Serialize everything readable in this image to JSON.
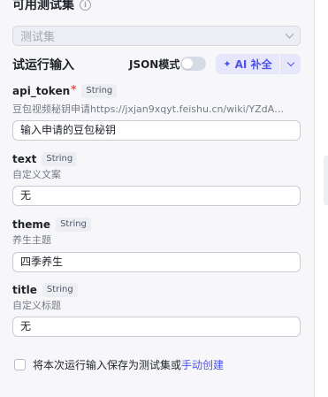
{
  "header": {
    "title": "可用测试集"
  },
  "testset_select": {
    "placeholder": "测试集"
  },
  "run_input": {
    "title": "试运行输入",
    "json_mode_label": "JSON模式",
    "json_mode_on": false,
    "ai_fill_label": "AI 补全"
  },
  "fields": [
    {
      "name": "api_token",
      "required": true,
      "type": "String",
      "description": "豆包视频秘钥申请https://jxjan9xqyt.feishu.cn/wiki/YZdA…",
      "value": "输入申请的豆包秘钥"
    },
    {
      "name": "text",
      "required": false,
      "type": "String",
      "description": "自定义文案",
      "value": "无"
    },
    {
      "name": "theme",
      "required": false,
      "type": "String",
      "description": "养生主题",
      "value": "四季养生"
    },
    {
      "name": "title",
      "required": false,
      "type": "String",
      "description": "自定义标题",
      "value": "无"
    }
  ],
  "save_option": {
    "checked": false,
    "label": "将本次运行输入保存为测试集或",
    "link": "手动创建"
  },
  "colors": {
    "accent": "#4d53e8",
    "required": "#f54a45",
    "panel_bg": "#f7f7f9"
  }
}
